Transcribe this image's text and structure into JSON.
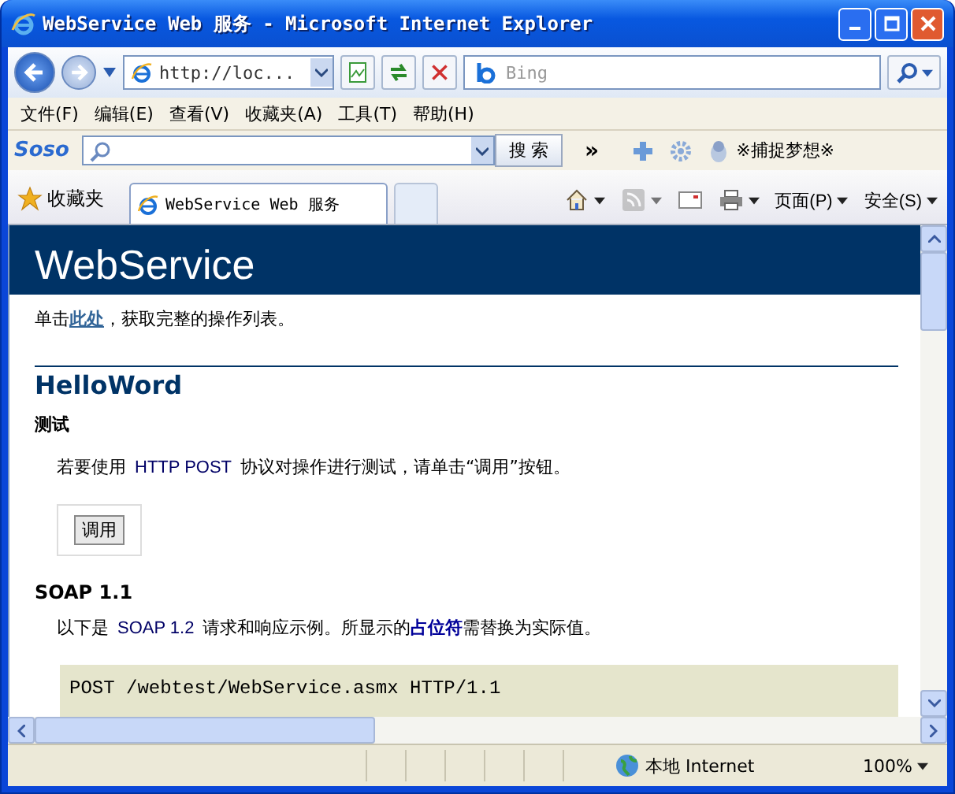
{
  "window": {
    "title": "WebService Web 服务 - Microsoft Internet Explorer"
  },
  "address_bar": {
    "value": "http://loc...",
    "search_placeholder": "Bing"
  },
  "menu": [
    "文件(F)",
    "编辑(E)",
    "查看(V)",
    "收藏夹(A)",
    "工具(T)",
    "帮助(H)"
  ],
  "soso_toolbar": {
    "logo": "Soso",
    "search_button": "搜 索",
    "overflow": "»",
    "user": "※捕捉梦想※"
  },
  "favorites_bar": {
    "favorites": "收藏夹",
    "tabs": [
      {
        "label": "WebService Web 服务",
        "selected": true
      },
      {
        "selected": false
      }
    ],
    "commands": [
      {
        "kind": "home"
      },
      {
        "kind": "feed"
      },
      {
        "kind": "mail"
      },
      {
        "kind": "print"
      },
      {
        "kind": "text",
        "label": "页面(P)"
      },
      {
        "kind": "text",
        "label": "安全(S)"
      }
    ]
  },
  "page": {
    "heading": "WebService",
    "intro": [
      {
        "kind": "text",
        "text": "单击"
      },
      {
        "kind": "link",
        "text": "此处"
      },
      {
        "kind": "text",
        "text": "，获取完整的操作列表。"
      }
    ],
    "method": "HelloWord",
    "test_heading": "测试",
    "test_text": [
      {
        "kind": "text",
        "text": "若要使用 "
      },
      {
        "kind": "code",
        "text": "HTTP POST"
      },
      {
        "kind": "text",
        "text": " 协议对操作进行测试，请单击“调用”按钮。"
      }
    ],
    "invoke_button": "调用",
    "soap_heading": "SOAP 1.1",
    "soap_text": [
      {
        "kind": "text",
        "text": "以下是 "
      },
      {
        "kind": "code",
        "text": "SOAP 1.2"
      },
      {
        "kind": "text",
        "text": " 请求和响应示例。所显示的"
      },
      {
        "kind": "strong",
        "text": "占位符"
      },
      {
        "kind": "text",
        "text": "需替换为实际值。"
      }
    ],
    "code": [
      "POST /webtest/WebService.asmx HTTP/1.1"
    ]
  },
  "status_bar": {
    "zone": "本地 Internet",
    "zoom": "100%"
  }
}
